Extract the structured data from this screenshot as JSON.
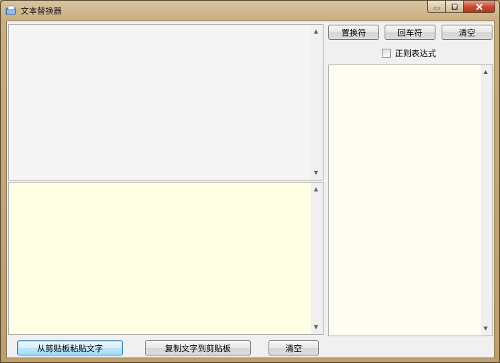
{
  "window": {
    "title": "文本替换器"
  },
  "buttons": {
    "replace_char": "置换符",
    "return_char": "回车符",
    "clear_right": "清空",
    "paste_from_clipboard": "从剪贴板粘贴文字",
    "copy_to_clipboard": "复制文字到剪贴板",
    "clear_bottom": "清空"
  },
  "options": {
    "regex_label": "正则表达式",
    "regex_checked": false
  },
  "text_areas": {
    "source": "",
    "result": "",
    "replace_rules": ""
  },
  "icons": {
    "app": "folder-note-icon",
    "minimize": "minimize-icon",
    "maximize": "maximize-icon",
    "close": "close-icon",
    "scroll_up": "scroll-up-arrow-icon",
    "scroll_down": "scroll-down-arrow-icon"
  },
  "colors": {
    "source_bg": "#f5f5f5",
    "result_bg": "#ffffe6",
    "rules_bg": "#fffcf2",
    "frame": "#c4a673"
  }
}
